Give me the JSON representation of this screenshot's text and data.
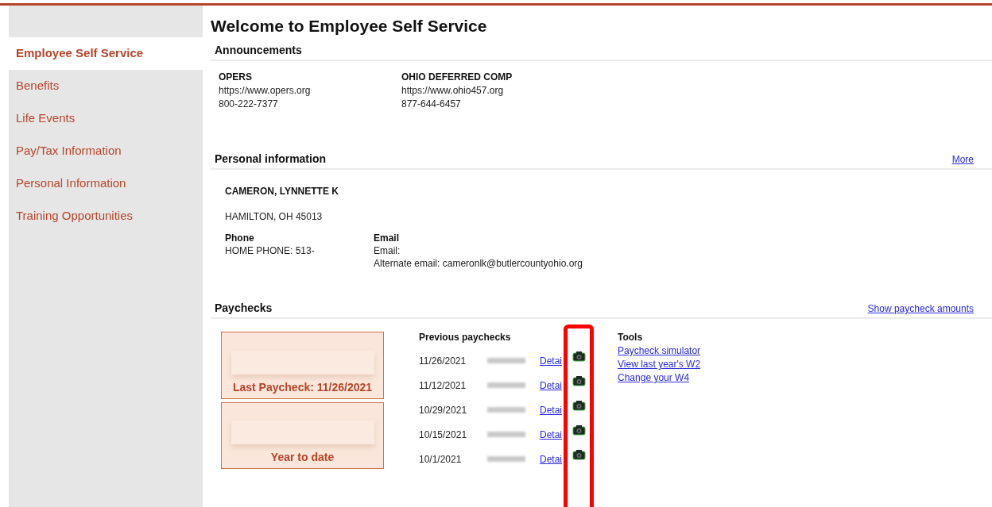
{
  "sidebar": {
    "items": [
      {
        "label": "Employee Self Service",
        "selected": true
      },
      {
        "label": "Benefits",
        "selected": false
      },
      {
        "label": "Life Events",
        "selected": false
      },
      {
        "label": "Pay/Tax Information",
        "selected": false
      },
      {
        "label": "Personal Information",
        "selected": false
      },
      {
        "label": "Training Opportunities",
        "selected": false
      }
    ]
  },
  "page_title": "Welcome to Employee Self Service",
  "announcements": {
    "heading": "Announcements",
    "items": [
      {
        "name": "OPERS",
        "url": "https://www.opers.org",
        "phone": "800-222-7377"
      },
      {
        "name": "OHIO DEFERRED COMP",
        "url": "https://www.ohio457.org",
        "phone": "877-644-6457"
      }
    ]
  },
  "personal_information": {
    "heading": "Personal information",
    "more_link": "More",
    "name": "CAMERON, LYNNETTE K",
    "address": "HAMILTON, OH 45013",
    "phone": {
      "label": "Phone",
      "lines": [
        "HOME PHONE: 513-"
      ]
    },
    "email": {
      "label": "Email",
      "lines": [
        "Email:",
        "Alternate email: cameronlk@butlercountyohio.org"
      ]
    }
  },
  "paychecks": {
    "heading": "Paychecks",
    "show_amounts_link": "Show paycheck amounts",
    "cards": [
      {
        "label": "Last Paycheck: 11/26/2021"
      },
      {
        "label": "Year to date"
      }
    ],
    "previous": {
      "heading": "Previous paychecks",
      "rows": [
        {
          "date": "11/26/2021",
          "link": "Detai"
        },
        {
          "date": "11/12/2021",
          "link": "Detai"
        },
        {
          "date": "10/29/2021",
          "link": "Detai"
        },
        {
          "date": "10/15/2021",
          "link": "Detai"
        },
        {
          "date": "10/1/2021",
          "link": "Detai"
        }
      ]
    },
    "tools": {
      "heading": "Tools",
      "links": [
        "Paycheck simulator",
        "View last year's W2",
        "Change your W4"
      ]
    }
  }
}
